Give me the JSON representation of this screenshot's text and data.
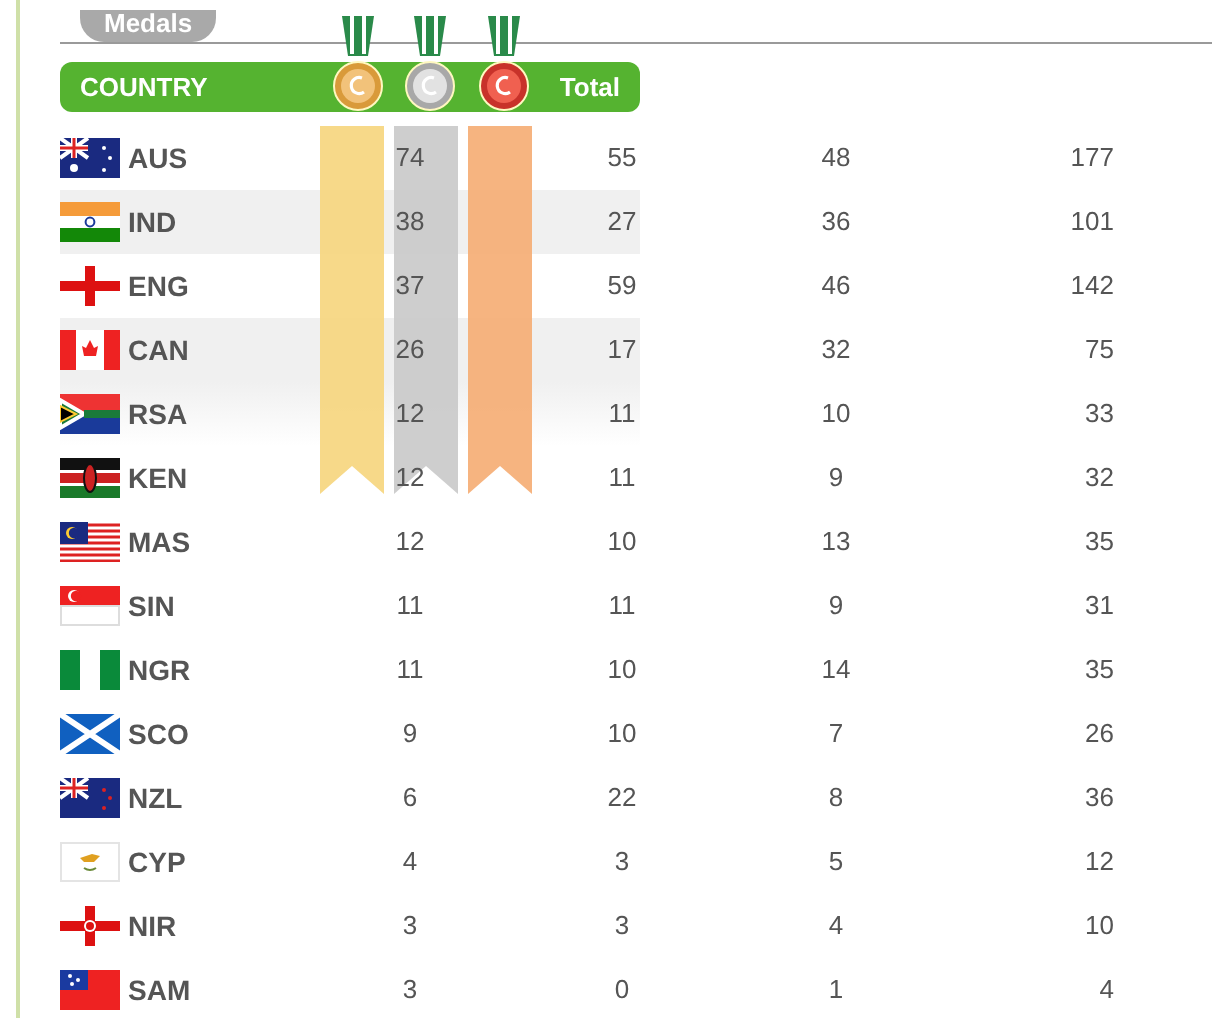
{
  "tab": {
    "label": "Medals"
  },
  "header": {
    "country": "COUNTRY",
    "total": "Total"
  },
  "rows": [
    {
      "code": "AUS",
      "gold": "74",
      "silver": "55",
      "bronze": "48",
      "total": "177"
    },
    {
      "code": "IND",
      "gold": "38",
      "silver": "27",
      "bronze": "36",
      "total": "101"
    },
    {
      "code": "ENG",
      "gold": "37",
      "silver": "59",
      "bronze": "46",
      "total": "142"
    },
    {
      "code": "CAN",
      "gold": "26",
      "silver": "17",
      "bronze": "32",
      "total": "75"
    },
    {
      "code": "RSA",
      "gold": "12",
      "silver": "11",
      "bronze": "10",
      "total": "33"
    },
    {
      "code": "KEN",
      "gold": "12",
      "silver": "11",
      "bronze": "9",
      "total": "32"
    },
    {
      "code": "MAS",
      "gold": "12",
      "silver": "10",
      "bronze": "13",
      "total": "35"
    },
    {
      "code": "SIN",
      "gold": "11",
      "silver": "11",
      "bronze": "9",
      "total": "31"
    },
    {
      "code": "NGR",
      "gold": "11",
      "silver": "10",
      "bronze": "14",
      "total": "35"
    },
    {
      "code": "SCO",
      "gold": "9",
      "silver": "10",
      "bronze": "7",
      "total": "26"
    },
    {
      "code": "NZL",
      "gold": "6",
      "silver": "22",
      "bronze": "8",
      "total": "36"
    },
    {
      "code": "CYP",
      "gold": "4",
      "silver": "3",
      "bronze": "5",
      "total": "12"
    },
    {
      "code": "NIR",
      "gold": "3",
      "silver": "3",
      "bronze": "4",
      "total": "10"
    },
    {
      "code": "SAM",
      "gold": "3",
      "silver": "0",
      "bronze": "1",
      "total": "4"
    }
  ]
}
